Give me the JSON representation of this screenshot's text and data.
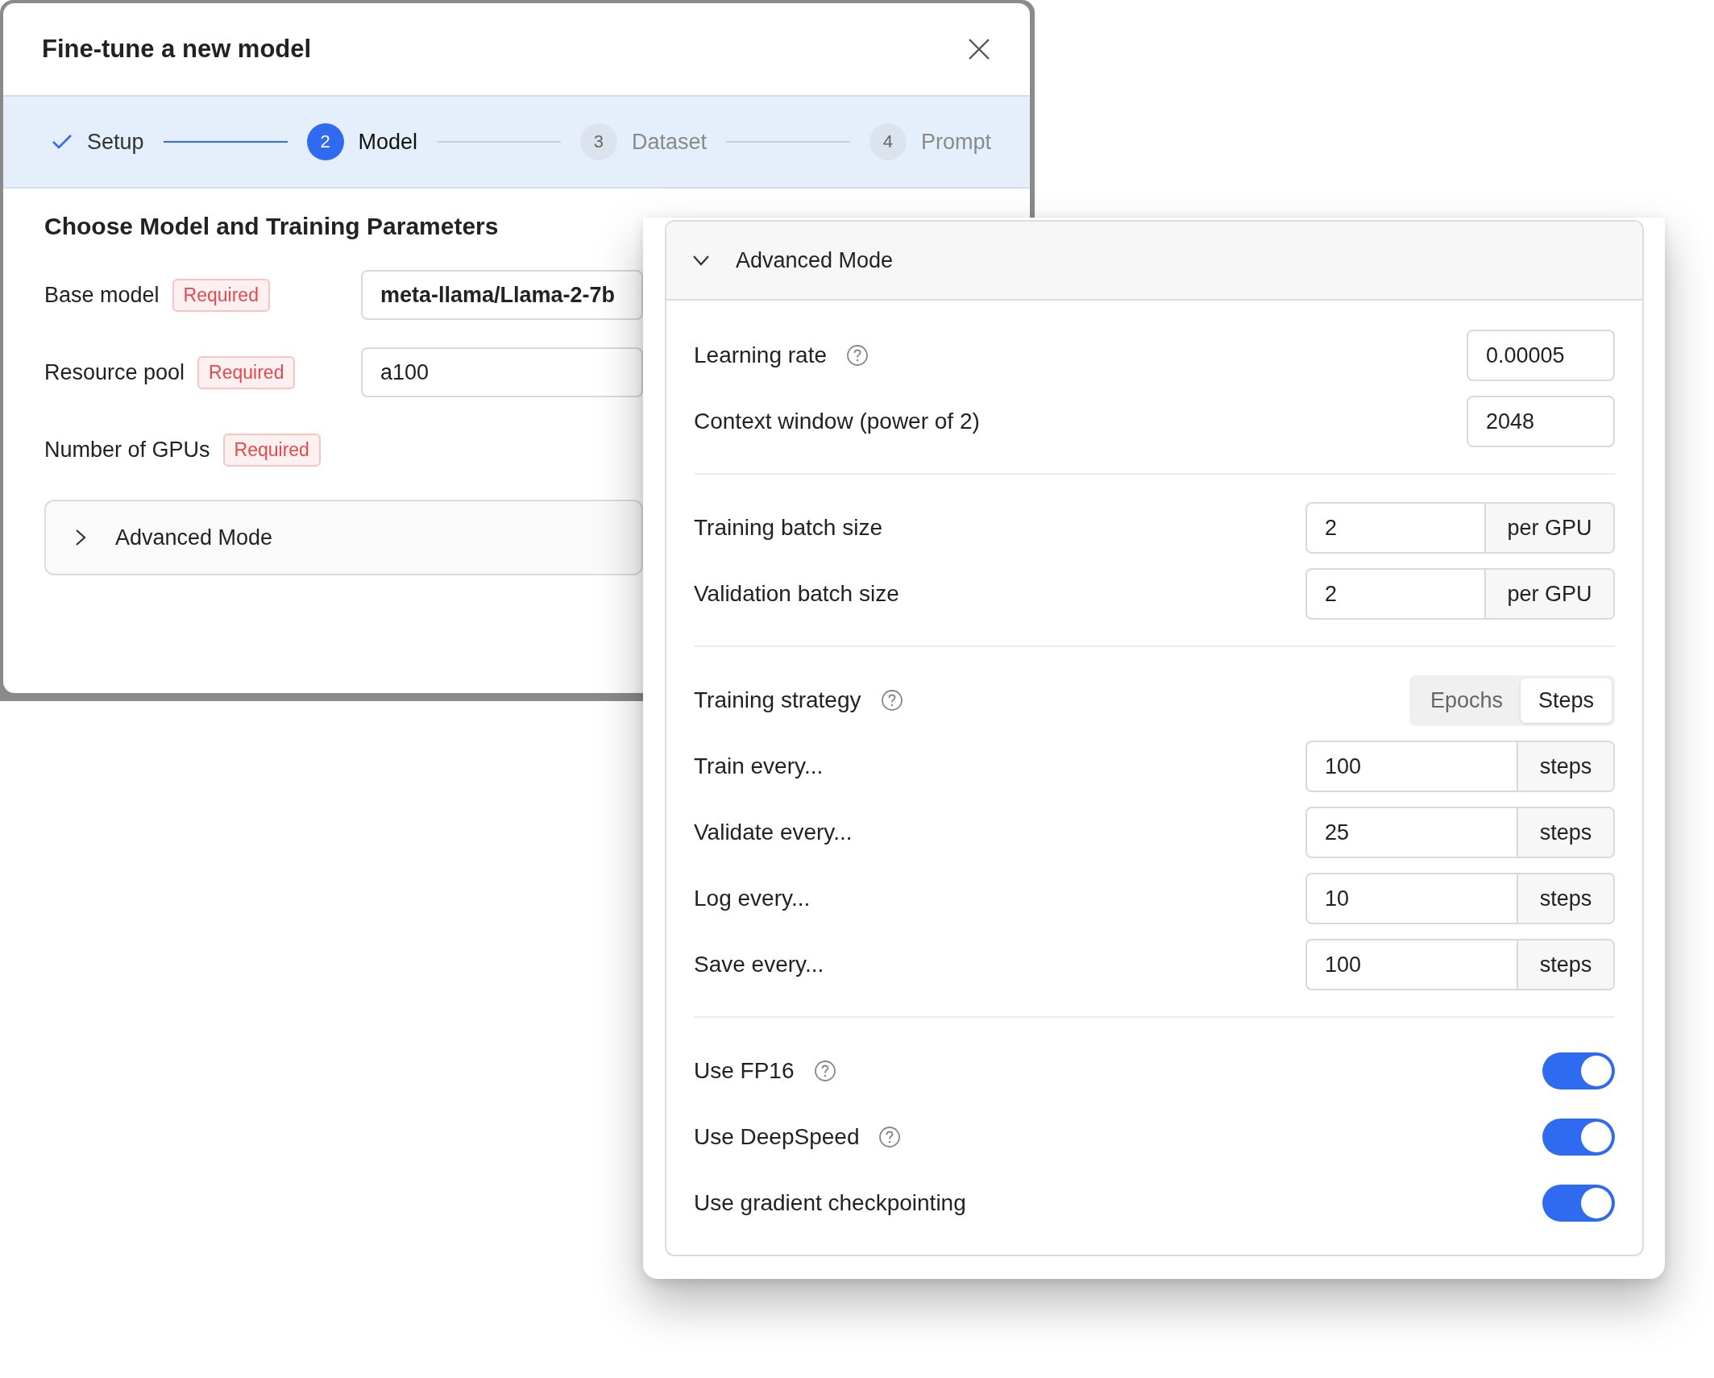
{
  "dialog": {
    "title": "Fine-tune a new model",
    "steps": [
      {
        "label": "Setup",
        "completed": true,
        "selected": false
      },
      {
        "label": "Model",
        "number": "2",
        "completed": false,
        "selected": true
      },
      {
        "label": "Dataset",
        "number": "3",
        "completed": false,
        "selected": false
      },
      {
        "label": "Prompt",
        "number": "4",
        "completed": false,
        "selected": false
      }
    ],
    "section_title": "Choose Model and Training Parameters",
    "fields": [
      {
        "label": "Base model",
        "badge": "Required",
        "value": "meta-llama/Llama-2-7b"
      },
      {
        "label": "Resource pool",
        "badge": "Required",
        "value": "a100"
      },
      {
        "label": "Number of GPUs",
        "badge": "Required"
      }
    ],
    "advanced_toggle": {
      "label": "Advanced Mode",
      "expanded": false
    }
  },
  "advanced_panel": {
    "title": "Advanced Mode",
    "expanded": true,
    "groups": [
      [
        {
          "kind": "input",
          "label": "Learning rate",
          "help": true,
          "value": "0.00005"
        },
        {
          "kind": "input",
          "label": "Context window (power of 2)",
          "help": false,
          "value": "2048"
        }
      ],
      [
        {
          "kind": "addon_input",
          "label": "Training batch size",
          "help": false,
          "value": "2",
          "unit": "per GPU"
        },
        {
          "kind": "addon_input",
          "label": "Validation batch size",
          "help": false,
          "value": "2",
          "unit": "per GPU"
        }
      ],
      [
        {
          "kind": "segmented",
          "label": "Training strategy",
          "help": true,
          "options": [
            {
              "label": "Epochs",
              "selected": false
            },
            {
              "label": "Steps",
              "selected": true
            }
          ]
        },
        {
          "kind": "addon_input",
          "label": "Train every...",
          "help": false,
          "value": "100",
          "unit": "steps"
        },
        {
          "kind": "addon_input",
          "label": "Validate every...",
          "help": false,
          "value": "25",
          "unit": "steps"
        },
        {
          "kind": "addon_input",
          "label": "Log every...",
          "help": false,
          "value": "10",
          "unit": "steps"
        },
        {
          "kind": "addon_input",
          "label": "Save every...",
          "help": false,
          "value": "100",
          "unit": "steps"
        }
      ],
      [
        {
          "kind": "toggle",
          "label": "Use FP16",
          "help": true,
          "on": true
        },
        {
          "kind": "toggle",
          "label": "Use DeepSpeed",
          "help": true,
          "on": true
        },
        {
          "kind": "toggle",
          "label": "Use gradient checkpointing",
          "help": false,
          "on": true
        }
      ]
    ]
  }
}
